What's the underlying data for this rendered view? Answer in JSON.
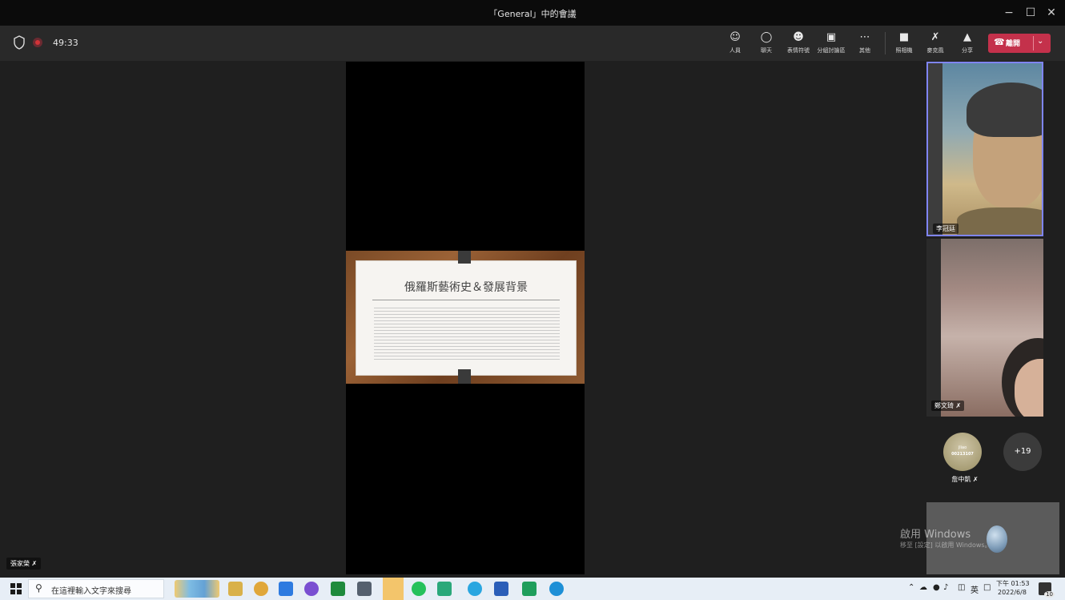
{
  "window": {
    "title": "「General」中的會議",
    "controls": {
      "minimize": "−",
      "maximize": "☐",
      "close": "✕"
    }
  },
  "toolbar": {
    "timer": "49:33",
    "buttons": [
      {
        "label": "人員",
        "icon": "people-icon"
      },
      {
        "label": "聊天",
        "icon": "chat-icon"
      },
      {
        "label": "表情符號",
        "icon": "emoji-icon"
      },
      {
        "label": "分組討論區",
        "icon": "breakout-rooms-icon"
      },
      {
        "label": "其他",
        "icon": "more-icon"
      },
      {
        "label": "照相機",
        "icon": "camera-off-icon"
      },
      {
        "label": "麥克風",
        "icon": "mic-off-icon"
      },
      {
        "label": "分享",
        "icon": "share-icon"
      }
    ],
    "leave_label": "離開",
    "leave_color": "#c4314b"
  },
  "stage": {
    "slide_title": "俄羅斯藝術史＆發展背景"
  },
  "participants": {
    "p1_name": "李冠廷",
    "p2_name": "鄭文琦",
    "avatar_line1": "jliao",
    "avatar_line2": "00213107",
    "avatar_name": "詹中凱",
    "more_count": "+19",
    "self_name": "張家榮"
  },
  "watermark": {
    "line1": "啟用 Windows",
    "line2": "移至 [設定] 以啟用 Windows。"
  },
  "taskbar": {
    "search_placeholder": "在這裡輸入文字來搜尋",
    "input_lang": "英",
    "time": "下午 01:53",
    "date": "2022/6/8",
    "notif_count": "10"
  },
  "accent": {
    "active_speaker_border": "#7f85f5"
  }
}
